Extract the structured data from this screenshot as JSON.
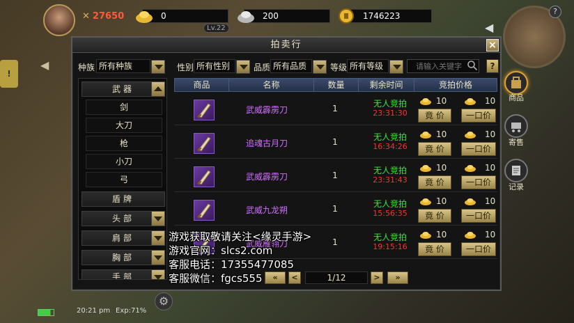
{
  "hud": {
    "power": "27650",
    "resources": [
      {
        "icon": "gold-ingot-icon",
        "value": "0"
      },
      {
        "icon": "silver-ingot-icon",
        "value": "200"
      },
      {
        "icon": "gold-coin-icon",
        "value": "1746223"
      }
    ],
    "level": "Lv.22"
  },
  "panel": {
    "title": "拍卖行",
    "close": "×",
    "filters": [
      {
        "label": "种族",
        "value": "所有种族"
      },
      {
        "label": "性别",
        "value": "所有性别"
      },
      {
        "label": "品质",
        "value": "所有品质"
      },
      {
        "label": "等级",
        "value": "所有等级"
      }
    ],
    "search_placeholder": "请输入关键字",
    "help": "?"
  },
  "categories": [
    {
      "label": "武器",
      "type": "head",
      "arrow": "up"
    },
    {
      "label": "剑",
      "type": "sub"
    },
    {
      "label": "大刀",
      "type": "sub"
    },
    {
      "label": "枪",
      "type": "sub"
    },
    {
      "label": "小刀",
      "type": "sub"
    },
    {
      "label": "弓",
      "type": "sub"
    },
    {
      "label": "盾牌",
      "type": "head"
    },
    {
      "label": "头部",
      "type": "head",
      "arrow": "down"
    },
    {
      "label": "肩部",
      "type": "head",
      "arrow": "down"
    },
    {
      "label": "胸部",
      "type": "head",
      "arrow": "down"
    },
    {
      "label": "手部",
      "type": "head",
      "arrow": "down"
    }
  ],
  "table": {
    "headers": [
      "商品",
      "名称",
      "数量",
      "剩余时间",
      "竞拍价格"
    ],
    "rows": [
      {
        "name": "武威霹雳刀",
        "qty": "1",
        "status": "无人竞拍",
        "time": "23:31:30",
        "bid": "10",
        "buyout": "10"
      },
      {
        "name": "追魂古月刀",
        "qty": "1",
        "status": "无人竞拍",
        "time": "16:34:26",
        "bid": "10",
        "buyout": "10"
      },
      {
        "name": "武威霹雳刀",
        "qty": "1",
        "status": "无人竞拍",
        "time": "23:31:43",
        "bid": "10",
        "buyout": "10"
      },
      {
        "name": "武威九龙朔",
        "qty": "1",
        "status": "无人竞拍",
        "time": "15:56:35",
        "bid": "10",
        "buyout": "10"
      },
      {
        "name": "武威雁翎刀",
        "qty": "1",
        "status": "无人竞拍",
        "time": "19:15:16",
        "bid": "10",
        "buyout": "10"
      }
    ],
    "bid_button": "竟 价",
    "buyout_button": "一口价"
  },
  "pager": {
    "text": "1/12",
    "first": "«",
    "prev": "<",
    "next": ">",
    "last": "»"
  },
  "right_tabs": [
    {
      "label": "商品",
      "active": true
    },
    {
      "label": "寄售",
      "active": false
    },
    {
      "label": "记录",
      "active": false
    }
  ],
  "overlay_lines": [
    "游戏获取敬请关注<缘灵手游>",
    "游戏官网：slcs2.com",
    "客服电话：17355477085",
    "客服微信：fgcs555"
  ],
  "status_bar": {
    "clock": "20:21 pm",
    "exp": "Exp:71%"
  }
}
